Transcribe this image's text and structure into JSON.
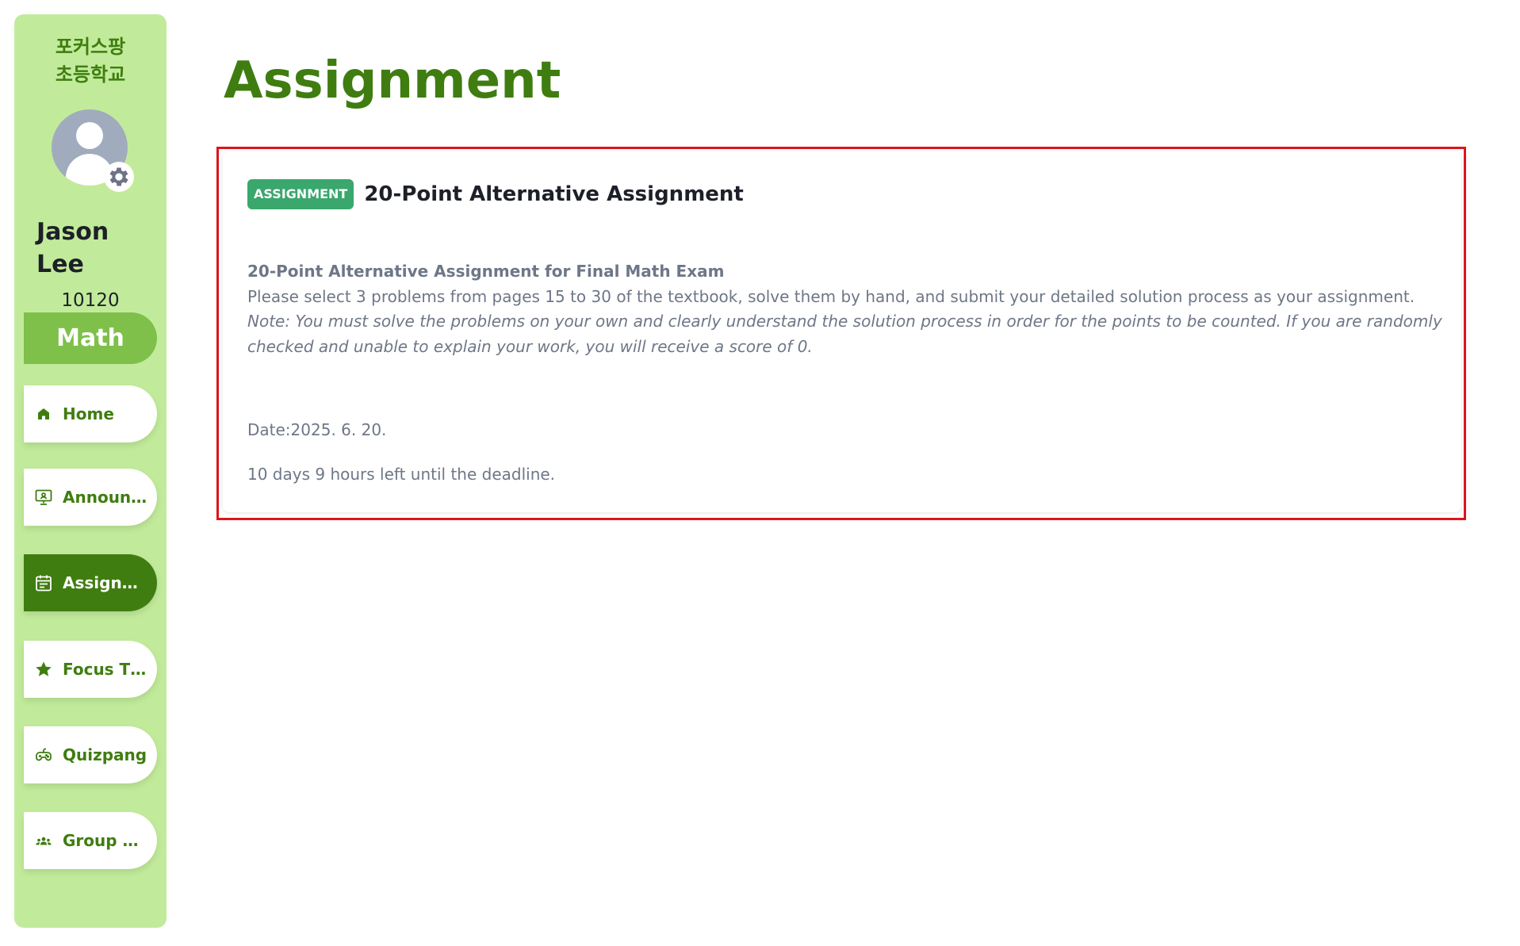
{
  "sidebar": {
    "school_name_line1": "포커스팡",
    "school_name_line2": "초등학교",
    "user": {
      "name_line1": "Jason",
      "name_line2": "Lee",
      "id": "10120"
    },
    "subject": "Math",
    "nav_items": [
      {
        "label": "Home",
        "icon": "home-icon",
        "active": false
      },
      {
        "label": "Announc...",
        "icon": "presentation-icon",
        "active": false
      },
      {
        "label": "Assignm...",
        "icon": "calendar-icon",
        "active": true
      },
      {
        "label": "Focus Ti...",
        "icon": "star-icon",
        "active": false
      },
      {
        "label": "Quizpang",
        "icon": "gamepad-icon",
        "active": false
      },
      {
        "label": "Group Ac...",
        "icon": "group-icon",
        "active": false
      }
    ]
  },
  "main": {
    "page_title": "Assignment",
    "card": {
      "badge": "ASSIGNMENT",
      "title": "20-Point Alternative Assignment",
      "subtitle": "20-Point Alternative Assignment for Final Math Exam",
      "instruction": "Please select 3 problems from pages 15 to 30 of the textbook, solve them by hand, and submit your detailed solution process as your assignment.",
      "note": "Note: You must solve the problems on your own and clearly understand the solution process in order for the points to be counted. If you are randomly checked and unable to explain your work, you will receive a score of 0.",
      "date": "Date:2025. 6. 20.",
      "deadline": "10 days 9 hours left until the deadline."
    }
  },
  "colors": {
    "sidebar_bg": "#c1eb9a",
    "brand_green": "#3f7d10",
    "subject_green": "#7ec04a",
    "badge_green": "#3aa76d",
    "highlight_red": "#e0131b",
    "body_text": "#6e7787"
  }
}
